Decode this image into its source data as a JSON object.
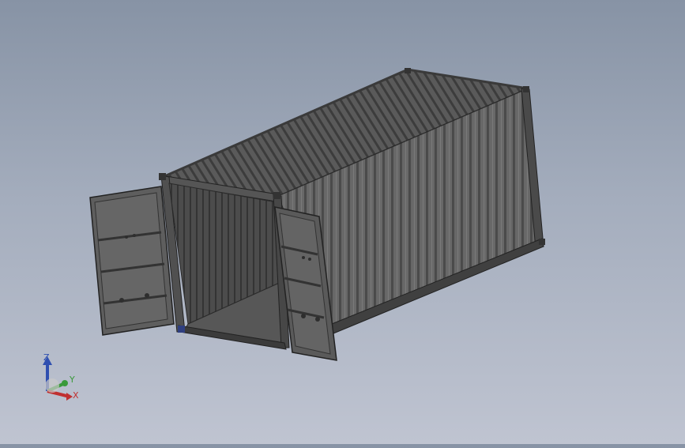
{
  "view": {
    "background_top": "#8793a5",
    "background_bottom": "#bfc4d1",
    "model_color": "#5e5e5e",
    "model_edge_color": "#2a2a2a"
  },
  "model": {
    "name": "container-assembly",
    "parts": [
      "container-body",
      "roof-panel",
      "side-wall",
      "interior-floor",
      "left-door",
      "right-door"
    ]
  },
  "triad": {
    "z_label": "Z",
    "y_label": "Y",
    "x_label": "X",
    "z_color": "#2f4fb0",
    "y_color": "#3a9a3a",
    "x_color": "#c03030"
  }
}
